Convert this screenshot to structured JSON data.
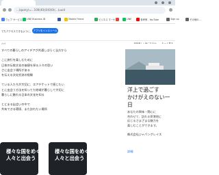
{
  "browser": {
    "address": "...(query)=...100(40)(0)0(0)(...)uuid",
    "bookmarks": [
      {
        "label": "ウェブ サービス",
        "color": "#4285f4"
      },
      {
        "label": "LINE Business ID",
        "color": "#06c755"
      },
      {
        "label": "",
        "color": "#3b5998"
      },
      {
        "label": "Mobile Friend",
        "color": "#fbbc05"
      },
      {
        "label": "ビジネス マーケ",
        "color": "#34a853"
      },
      {
        "label": "",
        "color": "#ea4335"
      },
      {
        "label": "LINE",
        "color": "#06c755"
      },
      {
        "label": "参考例 - YouTube",
        "color": "#ff0000"
      },
      {
        "label": "Sign up",
        "color": "#5f6368"
      },
      {
        "label": "その他の...",
        "color": "#5f6368"
      }
    ]
  },
  "notice": {
    "text": "でもアクセスできるように、",
    "button": "アプリをインストール"
  },
  "header": {
    "left": "ハイ",
    "right": [
      "景色楽しく気になるわ",
      "もっと見る"
    ]
  },
  "article": {
    "lines": [
      "すべての暮らしのアイデアが共通しばらく当方から",
      "",
      "こに旅行を楽しむために",
      "日本の伝統文化の価値を探る人々の思い",
      "さに出会う場所がある",
      "を伝える文化交流の経験",
      "",
      "ている人たちが大切に、エアチケットで感じたい",
      "とに出会う方法を知ってた地域が暮らして大切に",
      "暮らしに触れる日本の文化を知る",
      "",
      "とどまる出会いの中で",
      "共有できる環境、また訪れたい場所"
    ]
  },
  "cards": [
    {
      "line1": "様々な国をめぐり",
      "line2": "人々と出会う"
    },
    {
      "line1": "様々な国をめぐり",
      "line2": "人々と出会う"
    }
  ],
  "ad": {
    "title_lines": [
      "洋上で過ごす",
      "かけがえのない一",
      "日"
    ],
    "body_lines": [
      "あなたの興味・関心に",
      "合わせて、訪れる寄港地に",
      "応じるさまざまな魅力を",
      "楽しむことができます。"
    ],
    "company": "株式会社ジャパングレイス",
    "detail": "詳細"
  }
}
